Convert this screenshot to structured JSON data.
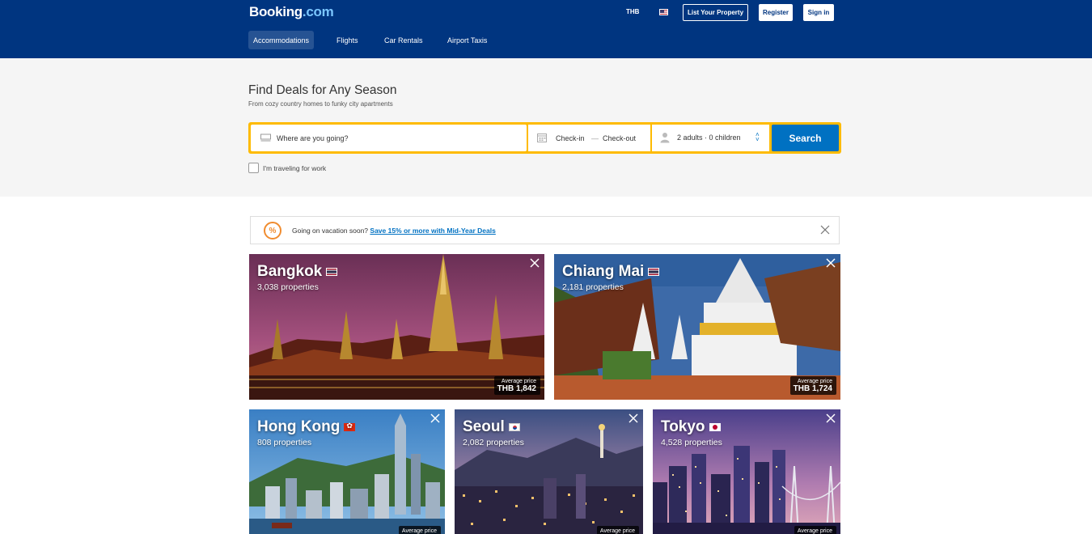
{
  "header": {
    "logo_main": "Booking",
    "logo_suffix": ".com",
    "currency": "THB",
    "list_property": "List Your Property",
    "register": "Register",
    "sign_in": "Sign in"
  },
  "nav": {
    "tabs": [
      {
        "label": "Accommodations",
        "active": true
      },
      {
        "label": "Flights",
        "active": false
      },
      {
        "label": "Car Rentals",
        "active": false
      },
      {
        "label": "Airport Taxis",
        "active": false
      }
    ]
  },
  "hero": {
    "title": "Find Deals for Any Season",
    "subtitle": "From cozy country homes to funky city apartments"
  },
  "search": {
    "destination_placeholder": "Where are you going?",
    "check_in": "Check-in",
    "dash": "—",
    "check_out": "Check-out",
    "guests": "2 adults  ·  0 children",
    "button": "Search",
    "work_label": "I'm traveling for work"
  },
  "promo": {
    "text": "Going on vacation soon? ",
    "link": "Save 15% or more with Mid-Year Deals"
  },
  "destinations": [
    {
      "city": "Bangkok",
      "properties": "3,038 properties",
      "price_label": "Average price",
      "price": "THB 1,842"
    },
    {
      "city": "Chiang Mai",
      "properties": "2,181 properties",
      "price_label": "Average price",
      "price": "THB 1,724"
    },
    {
      "city": "Hong Kong",
      "properties": "808 properties",
      "price_label": "Average price",
      "price": ""
    },
    {
      "city": "Seoul",
      "properties": "2,082 properties",
      "price_label": "Average price",
      "price": ""
    },
    {
      "city": "Tokyo",
      "properties": "4,528 properties",
      "price_label": "Average price",
      "price": ""
    }
  ],
  "colors": {
    "brand_blue": "#003580",
    "search_yellow": "#febb02",
    "search_button": "#0071c2"
  }
}
